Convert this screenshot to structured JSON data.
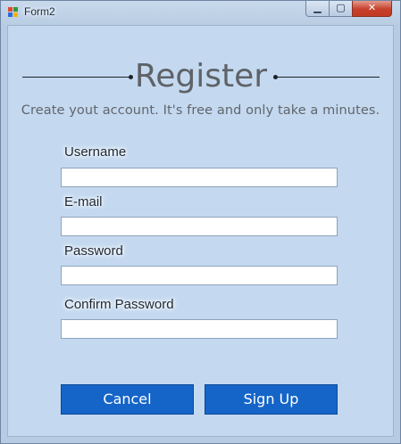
{
  "window": {
    "title": "Form2",
    "minimize_glyph": "▁",
    "maximize_glyph": "▢",
    "close_glyph": "✕"
  },
  "form": {
    "heading": "Register",
    "subtitle": "Create yout account. It's free and only take a minutes.",
    "fields": {
      "username": {
        "label": "Username",
        "value": ""
      },
      "email": {
        "label": "E-mail",
        "value": ""
      },
      "password": {
        "label": "Password",
        "value": ""
      },
      "confirm_password": {
        "label": "Confirm Password",
        "value": ""
      }
    },
    "buttons": {
      "cancel": "Cancel",
      "signup": "Sign Up"
    }
  },
  "colors": {
    "window_background": "#c4d9f0",
    "button_accent": "#1565c8",
    "close_button": "#c6402a"
  },
  "icons": {
    "app": "windows-form-icon",
    "minimize": "minimize-icon",
    "maximize": "maximize-icon",
    "close": "close-icon"
  }
}
